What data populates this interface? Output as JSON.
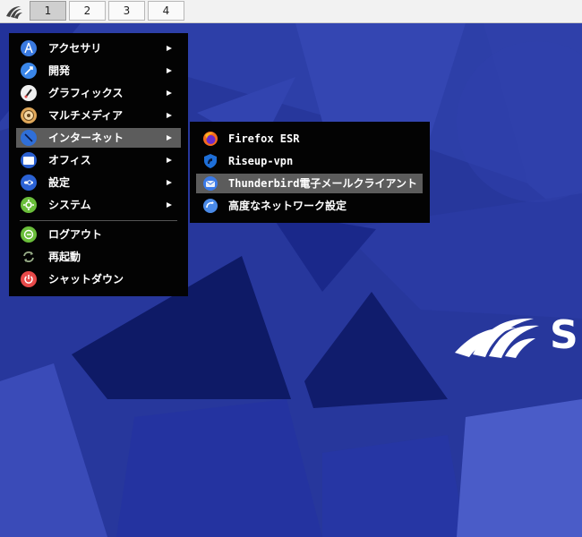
{
  "panel": {
    "workspaces": [
      "1",
      "2",
      "3",
      "4"
    ],
    "active_workspace": "1"
  },
  "main_menu": {
    "items": [
      {
        "label": "アクセサリ",
        "icon": "accessories-icon",
        "color": "#3a7ae0"
      },
      {
        "label": "開発",
        "icon": "development-icon",
        "color": "#3a86e8"
      },
      {
        "label": "グラフィックス",
        "icon": "graphics-icon",
        "color": "#f0f0f0"
      },
      {
        "label": "マルチメディア",
        "icon": "multimedia-icon",
        "color": "#e0a85a"
      },
      {
        "label": "インターネット",
        "icon": "internet-icon",
        "color": "#2f6fd8"
      },
      {
        "label": "オフィス",
        "icon": "office-icon",
        "color": "#2a5fcf"
      },
      {
        "label": "設定",
        "icon": "settings-icon",
        "color": "#2b62d4"
      },
      {
        "label": "システム",
        "icon": "system-icon",
        "color": "#6abe3a"
      }
    ],
    "session_items": [
      {
        "label": "ログアウト",
        "icon": "logout-icon",
        "color": "#6abe3a"
      },
      {
        "label": "再起動",
        "icon": "restart-icon",
        "color": "#7a9a6a"
      },
      {
        "label": "シャットダウン",
        "icon": "shutdown-icon",
        "color": "#e84a4a"
      }
    ],
    "highlighted": "インターネット"
  },
  "internet_submenu": {
    "items": [
      {
        "label": "Firefox ESR",
        "icon": "firefox-icon"
      },
      {
        "label": "Riseup-vpn",
        "icon": "riseup-vpn-icon"
      },
      {
        "label": "Thunderbird電子メールクライアント",
        "icon": "thunderbird-icon"
      },
      {
        "label": "高度なネットワーク設定",
        "icon": "network-settings-icon"
      }
    ],
    "highlighted": "Thunderbird電子メールクライアント"
  },
  "desktop": {
    "background_color": "#2a3aa0",
    "logo_text": "S"
  }
}
